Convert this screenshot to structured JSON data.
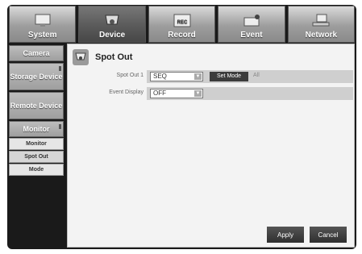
{
  "tabs": [
    {
      "label": "System",
      "icon": "monitor-icon",
      "active": false
    },
    {
      "label": "Device",
      "icon": "camera-icon",
      "active": true
    },
    {
      "label": "Record",
      "icon": "rec-icon",
      "active": false
    },
    {
      "label": "Event",
      "icon": "event-icon",
      "active": false
    },
    {
      "label": "Network",
      "icon": "network-icon",
      "active": false
    }
  ],
  "sidebar": {
    "items": [
      {
        "label": "Camera"
      },
      {
        "label": "Storage Device"
      },
      {
        "label": "Remote Device"
      },
      {
        "label": "Monitor"
      }
    ],
    "subitems": [
      {
        "label": "Monitor"
      },
      {
        "label": "Spot Out"
      },
      {
        "label": "Mode"
      }
    ]
  },
  "panel": {
    "title": "Spot Out",
    "spot_out": {
      "label": "Spot Out 1",
      "value": "SEQ",
      "set_mode_label": "Set Mode",
      "all_label": "All"
    },
    "event_display": {
      "label": "Event Display",
      "value": "OFF"
    },
    "apply_label": "Apply",
    "cancel_label": "Cancel"
  }
}
